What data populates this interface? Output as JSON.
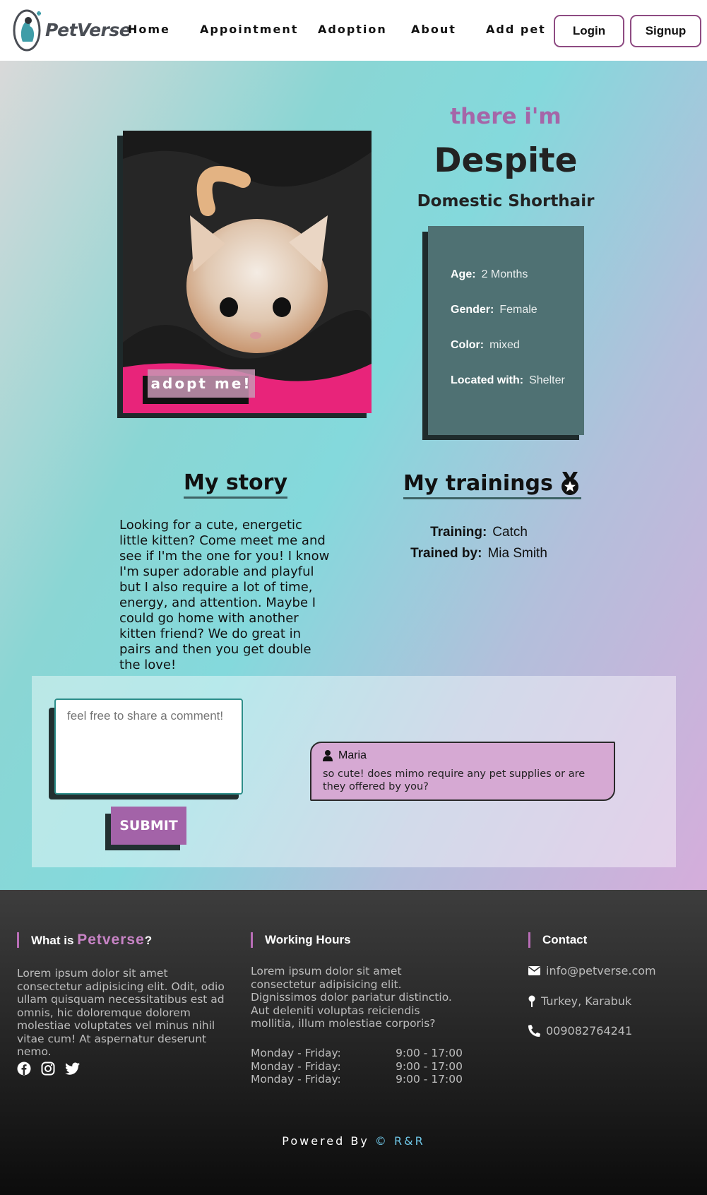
{
  "nav": {
    "brand": "PetVerse",
    "links": [
      "Home",
      "Appointment",
      "Adoption",
      "About",
      "Add pet"
    ],
    "login": "Login",
    "signup": "Signup"
  },
  "pet": {
    "greeting": "there i'm",
    "name": "Despite",
    "breed": "Domestic Shorthair",
    "adopt_label": "adopt me!",
    "details": [
      {
        "label": "Age:",
        "value": "2 Months"
      },
      {
        "label": "Gender:",
        "value": "Female"
      },
      {
        "label": "Color:",
        "value": "mixed"
      },
      {
        "label": "Located with:",
        "value": "Shelter"
      }
    ]
  },
  "story": {
    "heading": "My story",
    "text": "Looking for a cute, energetic little kitten? Come meet me and see if I'm the one for you! I know I'm super adorable and playful but I also require a lot of time, energy, and attention. Maybe I could go home with another kitten friend? We do great in pairs and then you get double the love!"
  },
  "trainings": {
    "heading": "My trainings",
    "training_label": "Training:",
    "training_value": "Catch",
    "trainer_label": "Trained by:",
    "trainer_value": "Mia Smith"
  },
  "comments": {
    "placeholder": "feel free to share a comment!",
    "submit": "SUBMIT",
    "items": [
      {
        "user": "Maria",
        "text": "so cute! does mimo require any pet supplies or are they offered by you?"
      }
    ]
  },
  "footer": {
    "about_heading_prefix": "What is",
    "about_heading_brand": "Petverse",
    "about_heading_suffix": "?",
    "about_text": "Lorem ipsum dolor sit amet consectetur adipisicing elit. Odit, odio ullam quisquam necessitatibus est ad omnis, hic doloremque dolorem molestiae voluptates vel minus nihil vitae cum! At aspernatur deserunt nemo.",
    "hours_heading": "Working Hours",
    "hours_text": "Lorem ipsum dolor sit amet consectetur adipisicing elit. Dignissimos dolor pariatur distinctio. Aut deleniti voluptas reiciendis mollitia, illum molestiae corporis?",
    "hours": [
      {
        "days": "Monday - Friday:",
        "time": "9:00 - 17:00"
      },
      {
        "days": "Monday - Friday:",
        "time": "9:00 - 17:00"
      },
      {
        "days": "Monday - Friday:",
        "time": "9:00 - 17:00"
      }
    ],
    "contact_heading": "Contact",
    "email": "info@petverse.com",
    "location": "Turkey, Karabuk",
    "phone": "009082764241",
    "powered_prefix": "Powered By",
    "powered_brand": "© R&R",
    "social_icons": [
      "facebook-icon",
      "instagram-icon",
      "twitter-icon"
    ]
  },
  "colors": {
    "accent_purple": "#a566a8",
    "info_panel": "#4f7173",
    "footer_dark": "#2c2c2c"
  }
}
